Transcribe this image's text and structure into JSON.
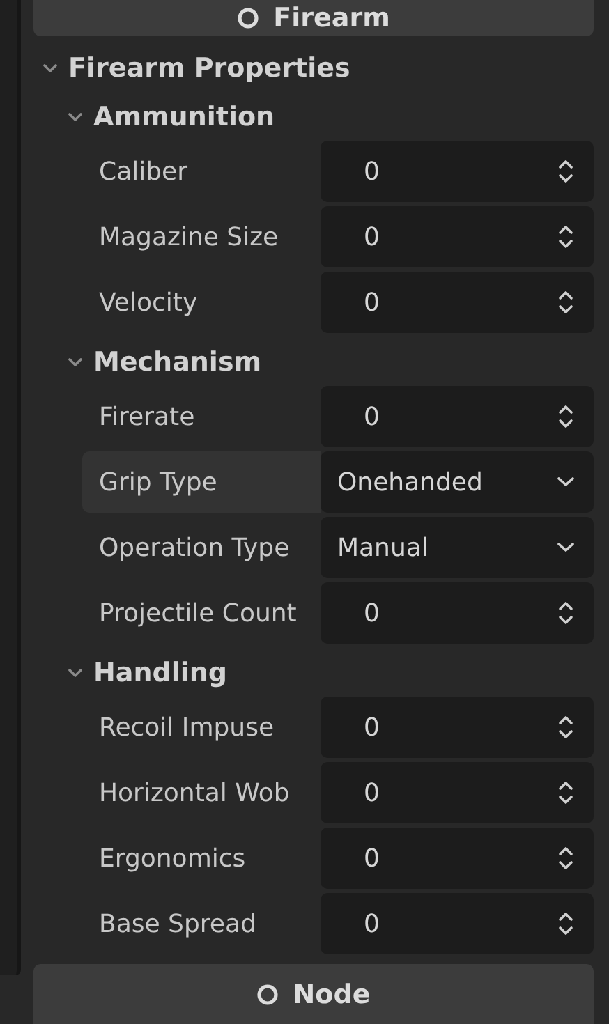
{
  "top_button": {
    "label": "Firearm"
  },
  "panel": {
    "title": "Firearm Properties",
    "expanded": true,
    "sections": [
      {
        "title": "Ammunition",
        "expanded": true,
        "fields": [
          {
            "label": "Caliber",
            "kind": "number",
            "value": "0",
            "highlighted": false
          },
          {
            "label": "Magazine Size",
            "kind": "number",
            "value": "0",
            "highlighted": false
          },
          {
            "label": "Velocity",
            "kind": "number",
            "value": "0",
            "highlighted": false
          }
        ]
      },
      {
        "title": "Mechanism",
        "expanded": true,
        "fields": [
          {
            "label": "Firerate",
            "kind": "number",
            "value": "0",
            "highlighted": false
          },
          {
            "label": "Grip Type",
            "kind": "enum",
            "value": "Onehanded",
            "highlighted": true
          },
          {
            "label": "Operation Type",
            "kind": "enum",
            "value": "Manual",
            "highlighted": false
          },
          {
            "label": "Projectile Count",
            "kind": "number",
            "value": "0",
            "highlighted": false
          }
        ]
      },
      {
        "title": "Handling",
        "expanded": true,
        "fields": [
          {
            "label": "Recoil Impuse",
            "kind": "number",
            "value": "0",
            "highlighted": false
          },
          {
            "label": "Horizontal Wob",
            "kind": "number",
            "value": "0",
            "highlighted": false
          },
          {
            "label": "Ergonomics",
            "kind": "number",
            "value": "0",
            "highlighted": false
          },
          {
            "label": "Base Spread",
            "kind": "number",
            "value": "0",
            "highlighted": false
          }
        ]
      }
    ]
  },
  "bottom_button": {
    "label": "Node"
  }
}
